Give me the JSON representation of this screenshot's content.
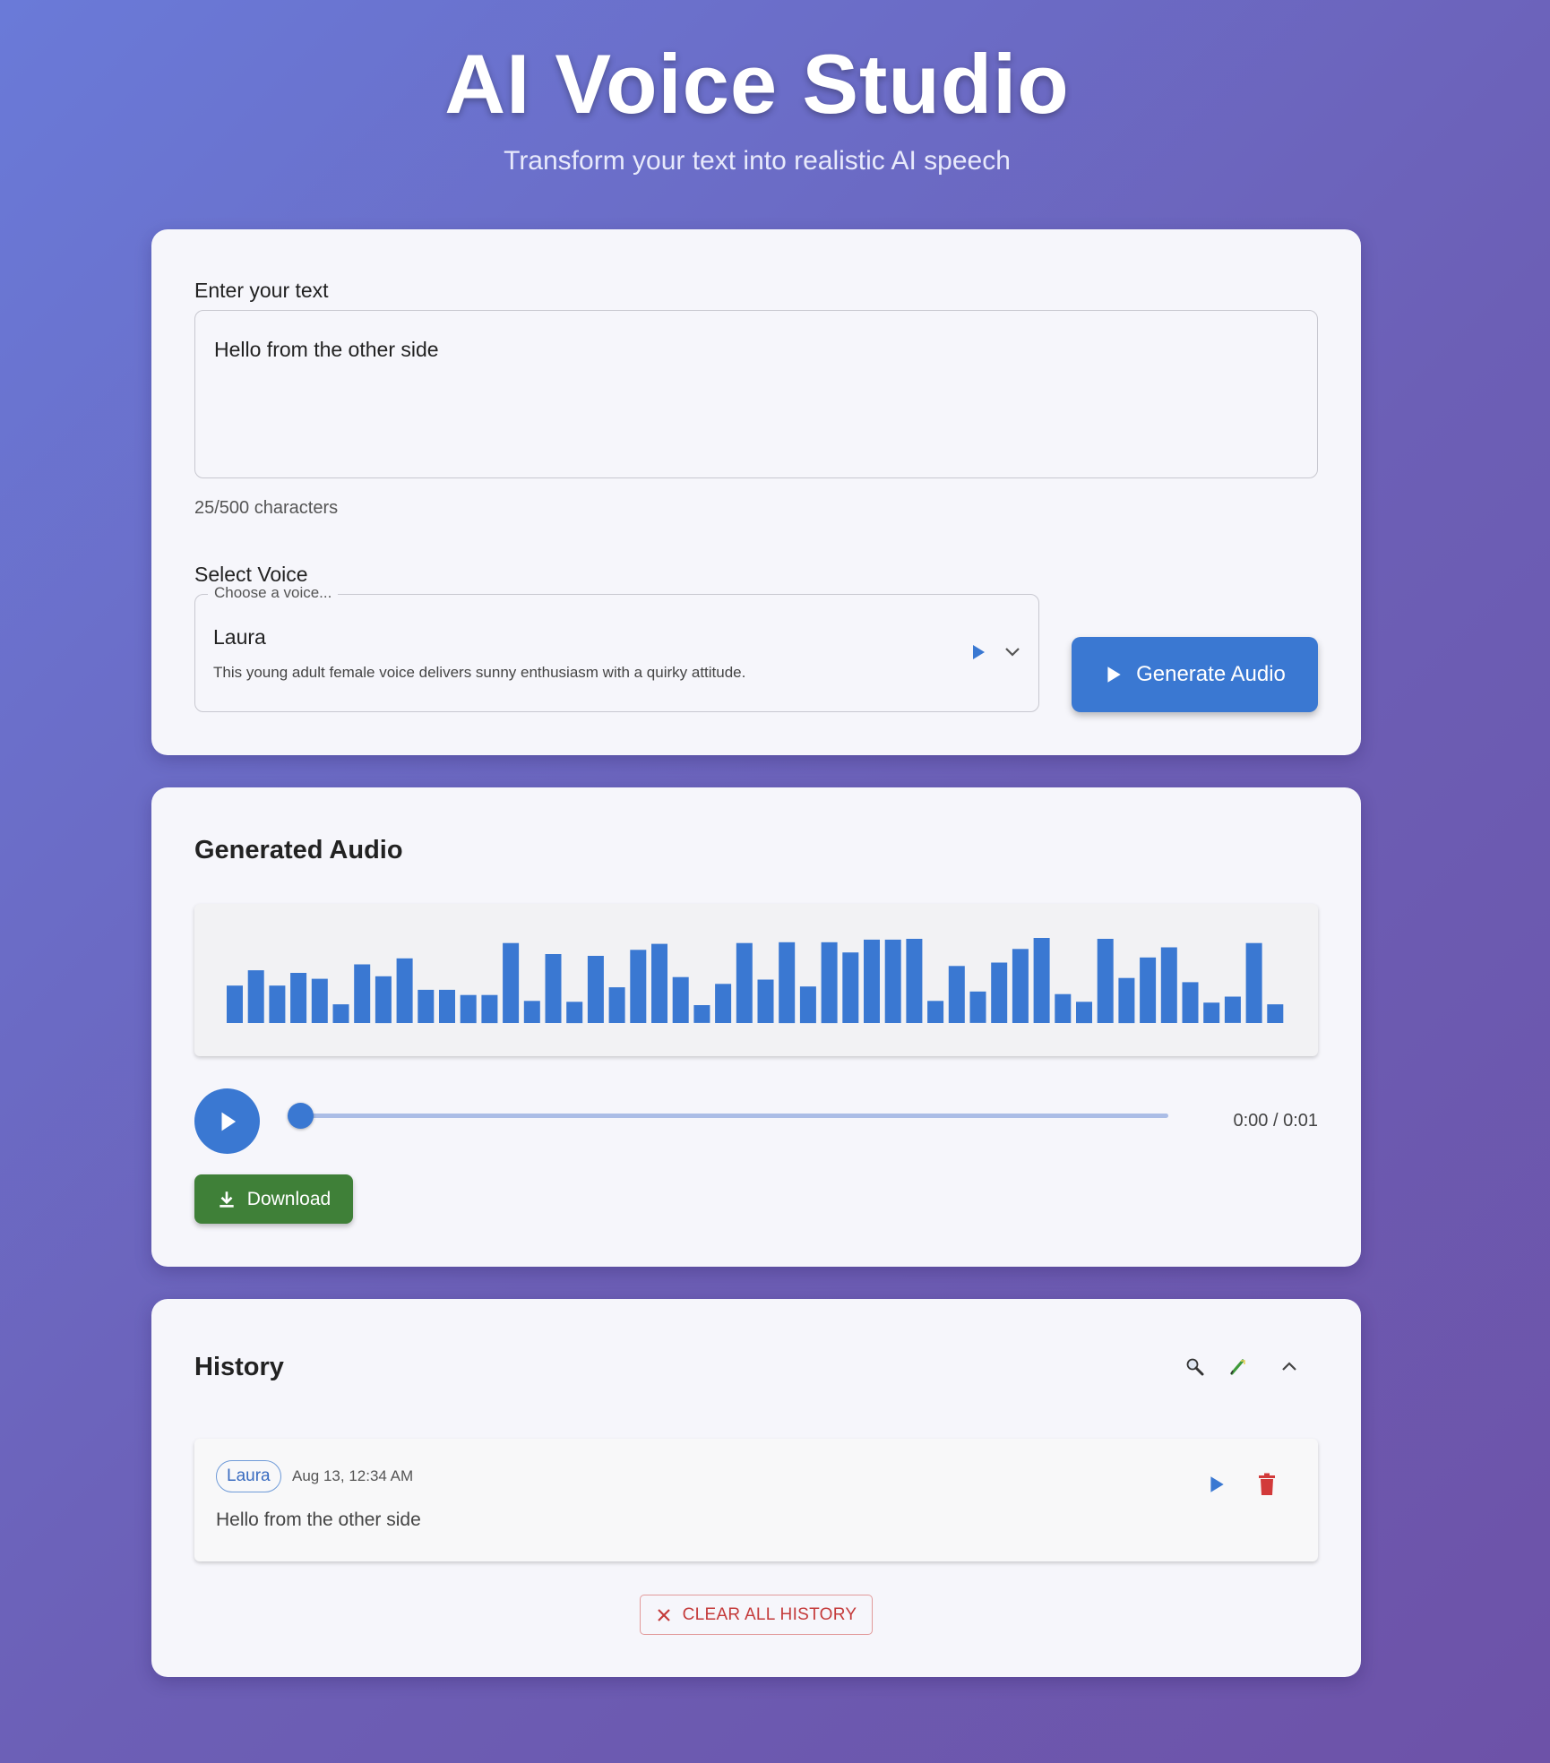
{
  "header": {
    "title": "AI Voice Studio",
    "subtitle": "Transform your text into realistic AI speech"
  },
  "input": {
    "label": "Enter your text",
    "value": "Hello from the other side",
    "char_count": "25/500 characters"
  },
  "voice": {
    "label": "Select Voice",
    "legend": "Choose a voice...",
    "selected": "Laura",
    "description": "This young adult female voice delivers sunny enthusiasm with a quirky attitude."
  },
  "generate_button": {
    "label": "Generate Audio"
  },
  "audio": {
    "title": "Generated Audio",
    "time": "0:00 / 0:01",
    "progress": 0,
    "download_label": "Download",
    "waveform_levels": [
      0.44,
      0.62,
      0.44,
      0.59,
      0.52,
      0.22,
      0.69,
      0.55,
      0.76,
      0.39,
      0.39,
      0.33,
      0.33,
      0.94,
      0.26,
      0.81,
      0.25,
      0.79,
      0.42,
      0.86,
      0.93,
      0.54,
      0.21,
      0.46,
      0.94,
      0.51,
      0.95,
      0.43,
      0.95,
      0.83,
      0.98,
      0.98,
      0.99,
      0.26,
      0.67,
      0.37,
      0.71,
      0.87,
      1.0,
      0.34,
      0.25,
      0.99,
      0.53,
      0.77,
      0.89,
      0.48,
      0.24,
      0.31,
      0.94,
      0.22
    ]
  },
  "history": {
    "title": "History",
    "items": [
      {
        "voice": "Laura",
        "time": "Aug 13, 12:34 AM",
        "text": "Hello from the other side"
      }
    ],
    "clear_label": "CLEAR ALL HISTORY"
  },
  "colors": {
    "primary": "#3a78d2",
    "download": "#3f8038",
    "danger": "#c43a3a"
  }
}
